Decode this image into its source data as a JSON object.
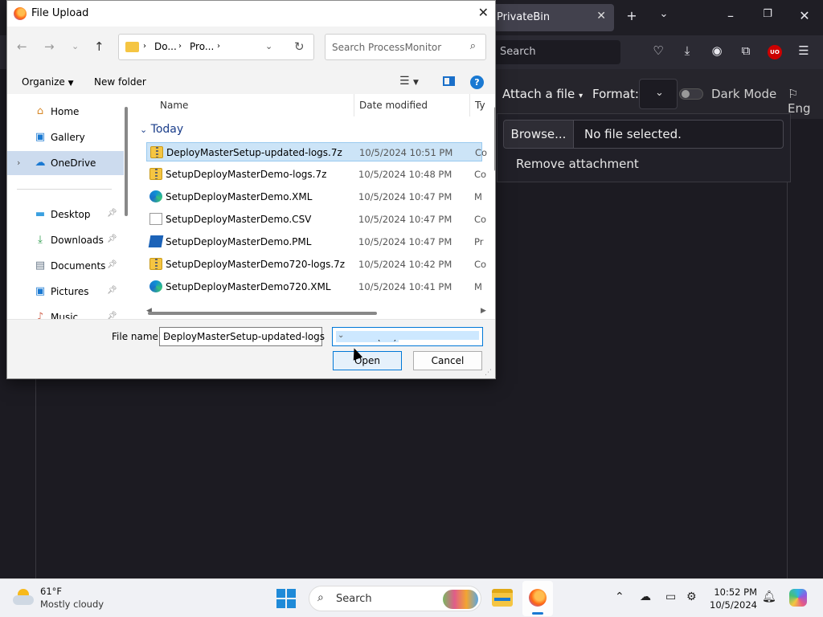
{
  "browser": {
    "tab_title": "PrivateBin",
    "url_placeholder": "Search",
    "toolbar": {
      "attach_label": "Attach a file",
      "format_label": "Format:",
      "dark_mode_label": "Dark Mode",
      "language_label": "Eng"
    },
    "attachment": {
      "browse_label": "Browse...",
      "no_file_label": "No file selected.",
      "remove_label": "Remove attachment"
    }
  },
  "dialog": {
    "title": "File Upload",
    "breadcrumb": [
      "Do...",
      "Pro..."
    ],
    "search_placeholder": "Search ProcessMonitor",
    "commands": {
      "organize": "Organize",
      "new_folder": "New folder"
    },
    "sidebar": [
      {
        "label": "Home",
        "icon": "home-icon"
      },
      {
        "label": "Gallery",
        "icon": "gallery-icon"
      },
      {
        "label": "OneDrive",
        "icon": "cloud-icon"
      },
      {
        "label": "Desktop",
        "icon": "desktop-icon"
      },
      {
        "label": "Downloads",
        "icon": "download-icon"
      },
      {
        "label": "Documents",
        "icon": "documents-icon"
      },
      {
        "label": "Pictures",
        "icon": "pictures-icon"
      },
      {
        "label": "Music",
        "icon": "music-icon"
      }
    ],
    "columns": [
      "Name",
      "Date modified",
      "Ty"
    ],
    "group": "Today",
    "files": [
      {
        "name": "DeployMasterSetup-updated-logs.7z",
        "date": "10/5/2024 10:51 PM",
        "type": "Co",
        "icon": "zip"
      },
      {
        "name": "SetupDeployMasterDemo-logs.7z",
        "date": "10/5/2024 10:48 PM",
        "type": "Co",
        "icon": "zip"
      },
      {
        "name": "SetupDeployMasterDemo.XML",
        "date": "10/5/2024 10:47 PM",
        "type": "M",
        "icon": "edge"
      },
      {
        "name": "SetupDeployMasterDemo.CSV",
        "date": "10/5/2024 10:47 PM",
        "type": "Co",
        "icon": "doc"
      },
      {
        "name": "SetupDeployMasterDemo.PML",
        "date": "10/5/2024 10:47 PM",
        "type": "Pr",
        "icon": "pml"
      },
      {
        "name": "SetupDeployMasterDemo720-logs.7z",
        "date": "10/5/2024 10:42 PM",
        "type": "Co",
        "icon": "zip"
      },
      {
        "name": "SetupDeployMasterDemo720.XML",
        "date": "10/5/2024 10:41 PM",
        "type": "M",
        "icon": "edge"
      }
    ],
    "file_name_label": "File name:",
    "file_name_value": "DeployMasterSetup-updated-logs",
    "file_type_value": "All Files (*.*)",
    "open_label": "Open",
    "cancel_label": "Cancel"
  },
  "taskbar": {
    "temperature": "61°F",
    "condition": "Mostly cloudy",
    "search_placeholder": "Search",
    "time": "10:52 PM",
    "date": "10/5/2024"
  }
}
